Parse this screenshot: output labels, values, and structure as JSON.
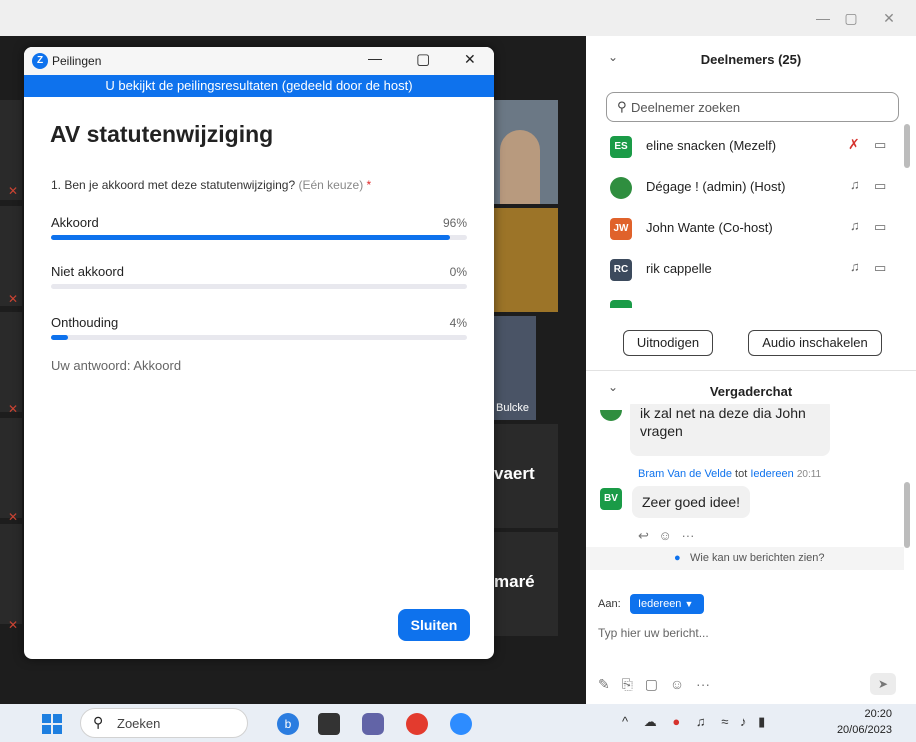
{
  "window": {
    "minimize": "—",
    "maximize": "▢",
    "close": "✕"
  },
  "tiles": {
    "bulcke": "Bulcke",
    "vaert": "vaert",
    "mare": "maré"
  },
  "poll": {
    "app_title": "Peilingen",
    "banner": "U bekijkt de peilingsresultaten (gedeeld door de host)",
    "title": "AV statutenwijziging",
    "question": "1. Ben je akkoord met deze statutenwijziging?",
    "question_type": "(Eén keuze)",
    "required_mark": "*",
    "options": [
      {
        "label": "Akkoord",
        "percent_text": "96%",
        "fraction": 0.96
      },
      {
        "label": "Niet akkoord",
        "percent_text": "0%",
        "fraction": 0.0
      },
      {
        "label": "Onthouding",
        "percent_text": "4%",
        "fraction": 0.04
      }
    ],
    "your_answer": "Uw antwoord: Akkoord",
    "close_button": "Sluiten",
    "accent": "#0e72ed"
  },
  "participants": {
    "header": "Deelnemers (25)",
    "search_placeholder": "Deelnemer zoeken",
    "list": [
      {
        "initials": "ES",
        "name": "eline snacken (Mezelf)",
        "color": "#1a9b47",
        "muted": true
      },
      {
        "initials": "",
        "name": "Dégage ! (admin) (Host)",
        "color": "#2f8e3f",
        "muted": false
      },
      {
        "initials": "JW",
        "name": "John Wante (Co-host)",
        "color": "#e0622b",
        "muted": false
      },
      {
        "initials": "RC",
        "name": "rik cappelle",
        "color": "#3c4a5d",
        "muted": false
      }
    ],
    "invite_button": "Uitnodigen",
    "audio_button": "Audio inschakelen"
  },
  "chat": {
    "header": "Vergaderchat",
    "prev_message": "ik zal net na deze dia John vragen",
    "sender": "Bram Van de Velde",
    "to_word": "tot",
    "to_target": "Iedereen",
    "time": "20:11",
    "avatar_initials": "BV",
    "avatar_color": "#1a9b47",
    "message": "Zeer goed idee!",
    "more": "···",
    "visibility": "Wie kan uw berichten zien?",
    "to_label": "Aan:",
    "recipient": "Iedereen",
    "input_placeholder": "Typ hier uw bericht..."
  },
  "taskbar": {
    "search": "Zoeken",
    "time": "20:20",
    "date": "20/06/2023"
  }
}
